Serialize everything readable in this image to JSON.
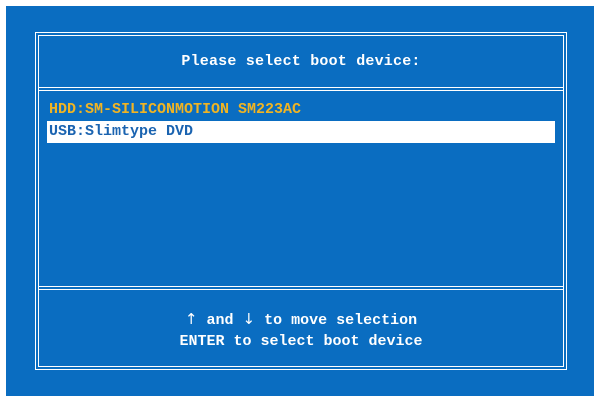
{
  "dialog": {
    "title": "Please select boot device:"
  },
  "devices": [
    {
      "label": "HDD:SM-SILICONMOTION SM223AC",
      "selected": false,
      "color": "#f0b423"
    },
    {
      "label": "USB:Slimtype DVD",
      "selected": true,
      "color": "#1a63b0"
    }
  ],
  "help": {
    "up_arrow": "↑",
    "and_text": " and ",
    "down_arrow": "↓",
    "move_text": " to move selection",
    "enter_text": "ENTER to select boot device"
  },
  "colors": {
    "background": "#0a6dc1",
    "text": "#ffffff",
    "highlight": "#f0b423"
  }
}
